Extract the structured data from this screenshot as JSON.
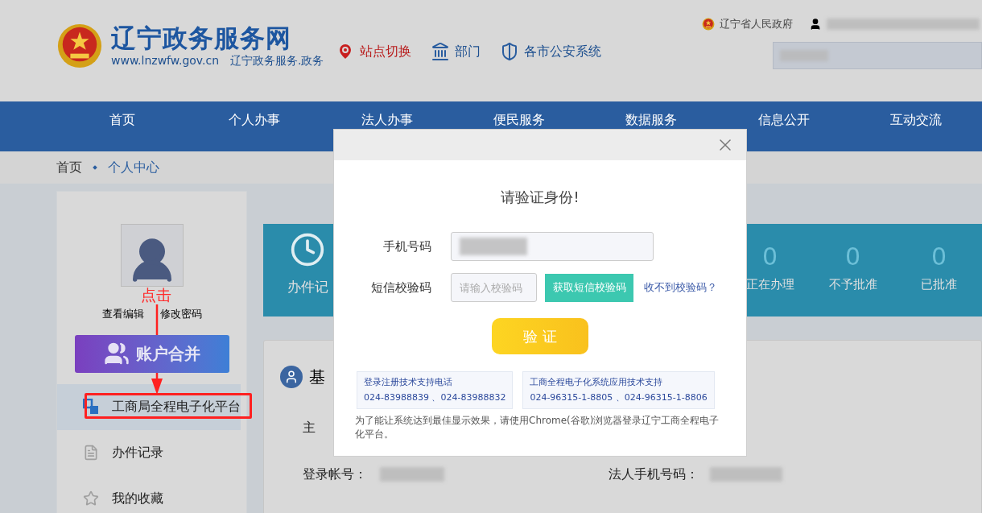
{
  "header": {
    "logo_title": "辽宁政务服务网",
    "logo_url": "www.lnzwfw.gov.cn",
    "logo_slogan": "辽宁政务服务.政务",
    "links": [
      {
        "label": "站点切换",
        "kind": "location"
      },
      {
        "label": "部门",
        "kind": "department"
      },
      {
        "label": "各市公安系统",
        "kind": "police"
      }
    ],
    "gov_link": "辽宁省人民政府"
  },
  "nav": [
    {
      "label": "首页"
    },
    {
      "label": "个人办事"
    },
    {
      "label": "法人办事"
    },
    {
      "label": "便民服务"
    },
    {
      "label": "数据服务"
    },
    {
      "label": "信息公开"
    },
    {
      "label": "互动交流"
    }
  ],
  "breadcrumb": [
    "首页",
    "个人中心"
  ],
  "sidebar": {
    "profile_links": [
      "查看编辑",
      "修改密码"
    ],
    "merge_banner": "账户合并",
    "items": [
      {
        "label": "工商局全程电子化平台",
        "kind": "platform",
        "selected": true
      },
      {
        "label": "办件记录",
        "kind": "records",
        "selected": false
      },
      {
        "label": "我的收藏",
        "kind": "favorites",
        "selected": false
      }
    ]
  },
  "stats": {
    "first_label": "办件记",
    "items": [
      {
        "value": "0",
        "label": "正在办理"
      },
      {
        "value": "0",
        "label": "不予批准"
      },
      {
        "value": "0",
        "label": "已批准"
      }
    ]
  },
  "info_card": {
    "title": "基",
    "fields": [
      {
        "label": "主"
      },
      {
        "label": "登录帐号："
      },
      {
        "label": "法人手机号码："
      }
    ]
  },
  "modal": {
    "title": "请验证身份!",
    "phone_label": "手机号码",
    "code_label": "短信校验码",
    "code_placeholder": "请输入校验码",
    "send_button": "获取短信校验码",
    "help_link": "收不到校验码？",
    "submit": "验 证",
    "support": [
      {
        "title": "登录注册技术支持电话",
        "phones": "024-83988839 、024-83988832"
      },
      {
        "title": "工商全程电子化系统应用技术支持",
        "phones": "024-96315-1-8805 、024-96315-1-8806"
      }
    ],
    "note": "为了能让系统达到最佳显示效果，请使用Chrome(谷歌)浏览器登录辽宁工商全程电子化平台。"
  },
  "annotation": {
    "label": "点击"
  }
}
